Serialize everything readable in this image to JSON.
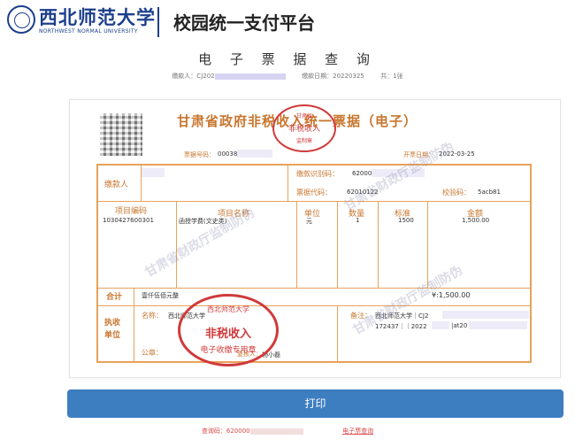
{
  "header": {
    "university_cn": "西北师范大学",
    "university_en": "NORTHWEST NORMAL UNIVERSITY",
    "platform_title": "校园统一支付平台"
  },
  "page_title": "电 子 票 据 查 询",
  "query_info": {
    "payer_label": "缴款人：CJ202",
    "date_label": "缴款日期：20220325",
    "count_label": "共：1张"
  },
  "invoice": {
    "title": "甘肃省政府非税收入统一票据（电子）",
    "receipt_no_label": "票据号码：",
    "receipt_no_value": "00038",
    "issue_date_label": "开票日期：",
    "issue_date_value": "2022-03-25",
    "payer_label": "缴款人",
    "payment_code_label": "缴款识别码：",
    "payment_code_value": "62000",
    "receipt_code_label": "票据代码：",
    "receipt_code_value": "62010122",
    "check_code_label": "校验码：",
    "check_code_value": "5acb81",
    "columns": {
      "item_code": "项目编码",
      "item_name": "项目名称",
      "unit": "单位",
      "quantity": "数量",
      "standard": "标准",
      "amount": "金额"
    },
    "row": {
      "item_code": "1030427600301",
      "item_name": "函授学费(文史类)",
      "unit": "元",
      "quantity": "1",
      "standard": "1500",
      "amount": "1,500.00"
    },
    "total_label": "合计",
    "total_words": "壹仟伍佰元整",
    "total_value": "¥:1,500.00",
    "collector_label": "执收单位",
    "collector_name_label": "名称：",
    "collector_name_value": "西北师范大学",
    "official_seal_label": "公章：",
    "reviewer_label": "复核人：",
    "reviewer_value": "杨小磊",
    "remark_label": "备注：",
    "remark_value_1": "西北师范大学｜CJ2",
    "remark_value_2": "172437｜｜2022",
    "remark_value_3": "|at20"
  },
  "stamps": {
    "top_top": "甘肃省",
    "top_mid": "非税收入",
    "top_bottom": "监制章",
    "main_top": "西北师范大学",
    "main_mid": "非税收入",
    "main_bottom": "电子收缴专用章"
  },
  "watermarks": {
    "left": "甘肃省财政厅监制防伪",
    "right": "甘肃省财政厅监制防伪",
    "mid": "甘肃省财政厅监制防伪"
  },
  "actions": {
    "print_label": "打印"
  },
  "footer": {
    "query_code_label": "查询码：620000",
    "link_label": "电子票查询"
  }
}
